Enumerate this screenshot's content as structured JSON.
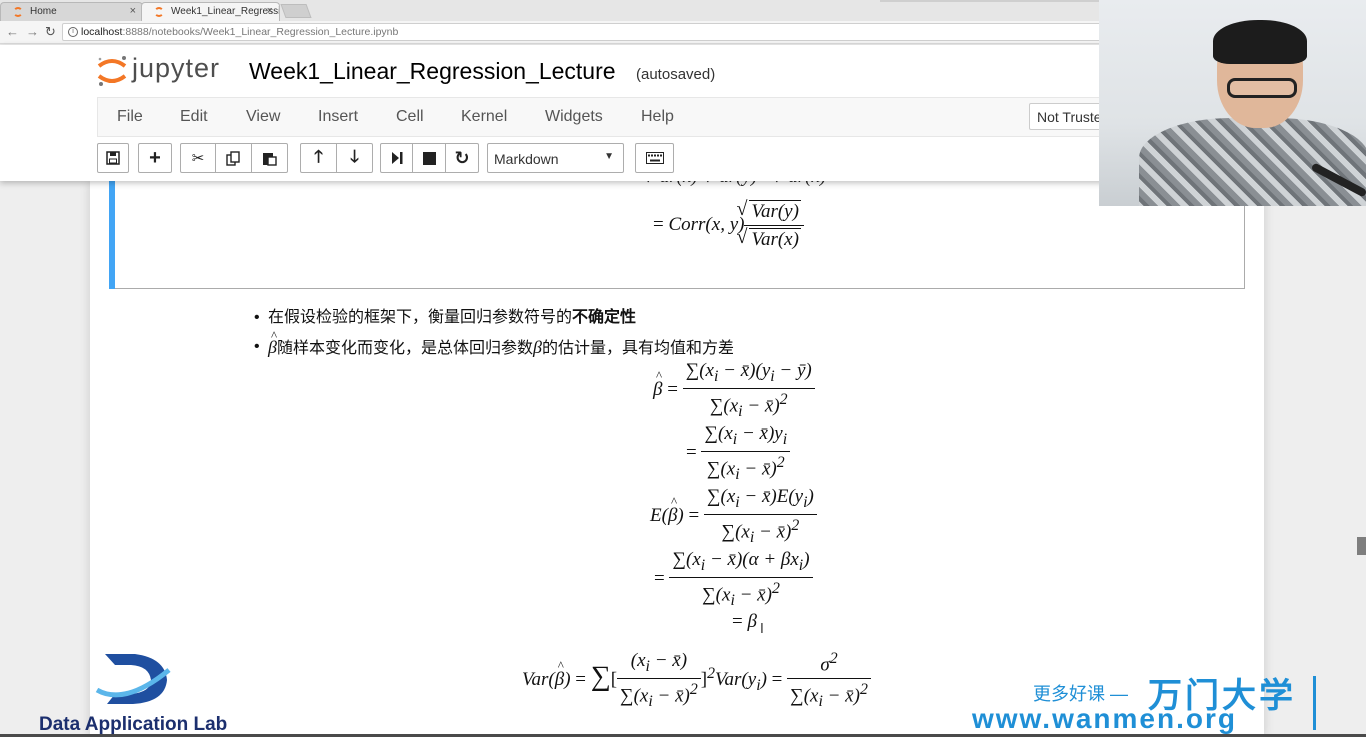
{
  "browser": {
    "tabs": [
      {
        "label": "Home",
        "close": "×"
      },
      {
        "label": "Week1_Linear_Regressi",
        "close": "×"
      }
    ],
    "url_host": "localhost",
    "url_path": ":8888/notebooks/Week1_Linear_Regression_Lecture.ipynb"
  },
  "jupyter": {
    "logo_text": "jupyter",
    "notebook_title": "Week1_Linear_Regression_Lecture",
    "save_status": "(autosaved)",
    "menu": [
      "File",
      "Edit",
      "View",
      "Insert",
      "Cell",
      "Kernel",
      "Widgets",
      "Help"
    ],
    "trust_button": "Not Truste",
    "cell_type": "Markdown",
    "toolbar_icons": [
      "save-icon",
      "plus-icon",
      "cut-icon",
      "copy-icon",
      "paste-icon",
      "arrow-up-icon",
      "arrow-down-icon",
      "run-icon",
      "stop-icon",
      "restart-icon",
      "keyboard-icon"
    ]
  },
  "notebook": {
    "bullets": [
      {
        "text": "在假设检验的框架下，衡量回归参数符号的",
        "bold": "不确定性"
      },
      {
        "prefix": "β",
        "text": "随样本变化而变化，是总体回归参数",
        "mid": "β",
        "suffix": "的估计量，具有均值和方差"
      }
    ]
  },
  "overlay": {
    "lab_name": "Data Application Lab",
    "slogan": "更多好课 —",
    "brand": "万门大学",
    "url": "www.wanmen.org"
  },
  "colors": {
    "selected_cell_bar": "#42a5f5",
    "wanmen_blue": "#1f8fd6",
    "jupyter_orange": "#f37726"
  }
}
